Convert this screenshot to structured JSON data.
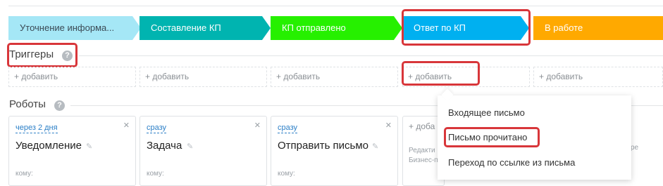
{
  "stages": [
    {
      "label": "Уточнение информа...",
      "color": "#a5e7f6"
    },
    {
      "label": "Составление КП",
      "color": "#00b4b0"
    },
    {
      "label": "КП отправлено",
      "color": "#26f000"
    },
    {
      "label": "Ответ по КП",
      "color": "#00b0f0"
    },
    {
      "label": "В работе",
      "color": "#ffa900"
    }
  ],
  "triggers": {
    "title": "Триггеры",
    "help": "?",
    "add_label": "+ добавить"
  },
  "robots": {
    "title": "Роботы",
    "help": "?",
    "cards": [
      {
        "when": "через 2 дня",
        "name": "Уведомление",
        "to": "кому:"
      },
      {
        "when": "сразу",
        "name": "Задача",
        "to": "кому:"
      },
      {
        "when": "сразу",
        "name": "Отправить письмо",
        "to": "кому:"
      }
    ],
    "partial_add": "+ доба",
    "partial_hint_1": "Редакти",
    "partial_hint_2": "Бизнес-п",
    "tail_text": "ре"
  },
  "dropdown": {
    "items": [
      "Входящее письмо",
      "Письмо прочитано",
      "Переход по ссылке из письма"
    ]
  },
  "highlight_color": "#d8363a"
}
